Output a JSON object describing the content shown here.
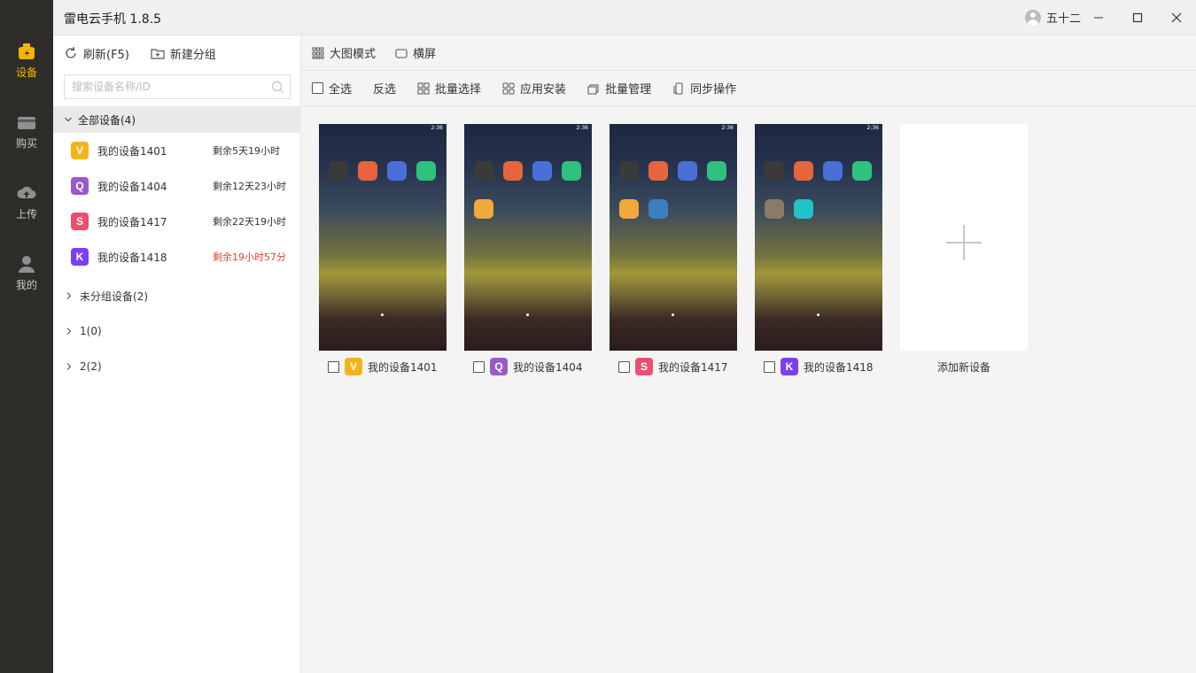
{
  "app": {
    "title": "雷电云手机 1.8.5"
  },
  "user": {
    "name": "五十二"
  },
  "rail": [
    {
      "label": "设备",
      "icon": "device-icon",
      "active": true
    },
    {
      "label": "购买",
      "icon": "card-icon",
      "active": false
    },
    {
      "label": "上传",
      "icon": "cloud-upload-icon",
      "active": false
    },
    {
      "label": "我的",
      "icon": "user-icon",
      "active": false
    }
  ],
  "sidebar": {
    "refresh": "刷新(F5)",
    "new_group": "新建分组",
    "search_placeholder": "搜索设备名称/ID",
    "all_group": "全部设备(4)",
    "devices": [
      {
        "badge": "V",
        "color": "#f6b21a",
        "name": "我的设备1401",
        "remain": "剩余5天19小时",
        "warn": false
      },
      {
        "badge": "Q",
        "color": "#9b59c9",
        "name": "我的设备1404",
        "remain": "剩余12天23小时",
        "warn": false
      },
      {
        "badge": "S",
        "color": "#ef4d6f",
        "name": "我的设备1417",
        "remain": "剩余22天19小时",
        "warn": false
      },
      {
        "badge": "K",
        "color": "#7b3ff0",
        "name": "我的设备1418",
        "remain": "剩余19小时57分",
        "warn": true
      }
    ],
    "groups": [
      "未分组设备(2)",
      "1(0)",
      "2(2)"
    ]
  },
  "toolbar": {
    "big_mode": "大图模式",
    "landscape": "横屏",
    "select_all": "全选",
    "invert": "反选",
    "batch_select": "批量选择",
    "app_install": "应用安装",
    "batch_manage": "批量管理",
    "sync_ops": "同步操作"
  },
  "cards": [
    {
      "badge": "V",
      "color": "#f6b21a",
      "name": "我的设备1401",
      "time": "2:36"
    },
    {
      "badge": "Q",
      "color": "#9b59c9",
      "name": "我的设备1404",
      "time": "2:36"
    },
    {
      "badge": "S",
      "color": "#ef4d6f",
      "name": "我的设备1417",
      "time": "2:36"
    },
    {
      "badge": "K",
      "color": "#7b3ff0",
      "name": "我的设备1418",
      "time": "2:36"
    }
  ],
  "add_device": "添加新设备"
}
